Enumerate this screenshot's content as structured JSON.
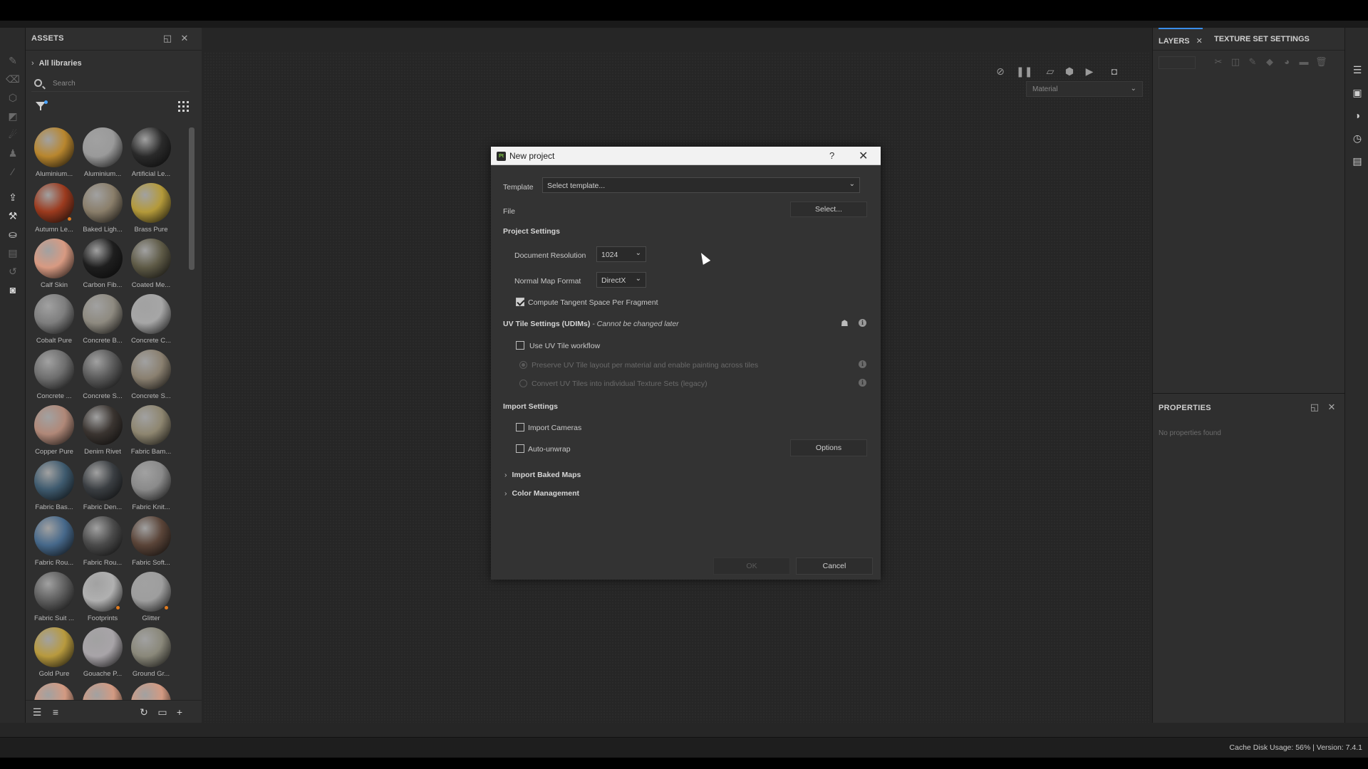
{
  "assets": {
    "title": "ASSETS",
    "library": "All libraries",
    "search_placeholder": "Search",
    "items": [
      {
        "label": "Aluminium...",
        "color": "#b8862e"
      },
      {
        "label": "Aluminium...",
        "color": "#9a9a9a"
      },
      {
        "label": "Artificial Le...",
        "color": "#2a2a2a"
      },
      {
        "label": "Autumn Le...",
        "color": "#9b3a1e",
        "badge": true
      },
      {
        "label": "Baked Ligh...",
        "color": "#8a7e6a"
      },
      {
        "label": "Brass Pure",
        "color": "#b49a3a"
      },
      {
        "label": "Calf Skin",
        "color": "#d89a82"
      },
      {
        "label": "Carbon Fib...",
        "color": "#1e1e1e"
      },
      {
        "label": "Coated Me...",
        "color": "#5e5a46"
      },
      {
        "label": "Cobalt Pure",
        "color": "#7e7e7e"
      },
      {
        "label": "Concrete B...",
        "color": "#8e8a80"
      },
      {
        "label": "Concrete C...",
        "color": "#a6a6a6"
      },
      {
        "label": "Concrete ...",
        "color": "#6e6e6e"
      },
      {
        "label": "Concrete S...",
        "color": "#5a5a5a"
      },
      {
        "label": "Concrete S...",
        "color": "#8a8070"
      },
      {
        "label": "Copper Pure",
        "color": "#b08878"
      },
      {
        "label": "Denim Rivet",
        "color": "#3a3430"
      },
      {
        "label": "Fabric Bam...",
        "color": "#8e8670"
      },
      {
        "label": "Fabric Bas...",
        "color": "#3e5a6e"
      },
      {
        "label": "Fabric Den...",
        "color": "#3a3e42"
      },
      {
        "label": "Fabric Knit...",
        "color": "#8a8a8a"
      },
      {
        "label": "Fabric Rou...",
        "color": "#46688a"
      },
      {
        "label": "Fabric Rou...",
        "color": "#4a4a4a"
      },
      {
        "label": "Fabric Soft...",
        "color": "#5a4438"
      },
      {
        "label": "Fabric Suit ...",
        "color": "#5e5e5e"
      },
      {
        "label": "Footprints",
        "color": "#b0b0b0",
        "badge": true
      },
      {
        "label": "Glitter",
        "color": "#9e9e9e",
        "badge": true
      },
      {
        "label": "Gold Pure",
        "color": "#b89a3e"
      },
      {
        "label": "Gouache P...",
        "color": "#a8a4a8"
      },
      {
        "label": "Ground Gr...",
        "color": "#8a887a"
      },
      {
        "label": "",
        "color": "#d39a82"
      },
      {
        "label": "",
        "color": "#d39a82"
      },
      {
        "label": "",
        "color": "#d39a82"
      }
    ]
  },
  "viewport": {
    "material_select": "Material"
  },
  "right": {
    "tab_layers": "LAYERS",
    "tab_texture": "TEXTURE SET SETTINGS",
    "properties_title": "PROPERTIES",
    "no_properties": "No properties found"
  },
  "status": {
    "text": "Cache Disk Usage:    56% | Version: 7.4.1"
  },
  "dialog": {
    "title": "New project",
    "help": "?",
    "template_label": "Template",
    "template_value": "Select template...",
    "file_label": "File",
    "file_button": "Select...",
    "project_settings": "Project Settings",
    "doc_res_label": "Document Resolution",
    "doc_res_value": "1024",
    "normal_label": "Normal Map Format",
    "normal_value": "DirectX",
    "tangent_label": "Compute Tangent Space Per Fragment",
    "tangent_checked": true,
    "udim_title": "UV Tile Settings (UDIMs)",
    "udim_note": "- Cannot be changed later",
    "use_uv_label": "Use UV Tile workflow",
    "preserve_label": "Preserve UV Tile layout per material and enable painting across tiles",
    "convert_label": "Convert UV Tiles into individual Texture Sets (legacy)",
    "import_settings": "Import Settings",
    "import_cameras": "Import Cameras",
    "auto_unwrap": "Auto-unwrap",
    "options_button": "Options",
    "import_baked": "Import Baked Maps",
    "color_mgmt": "Color Management",
    "ok_button": "OK",
    "cancel_button": "Cancel"
  }
}
